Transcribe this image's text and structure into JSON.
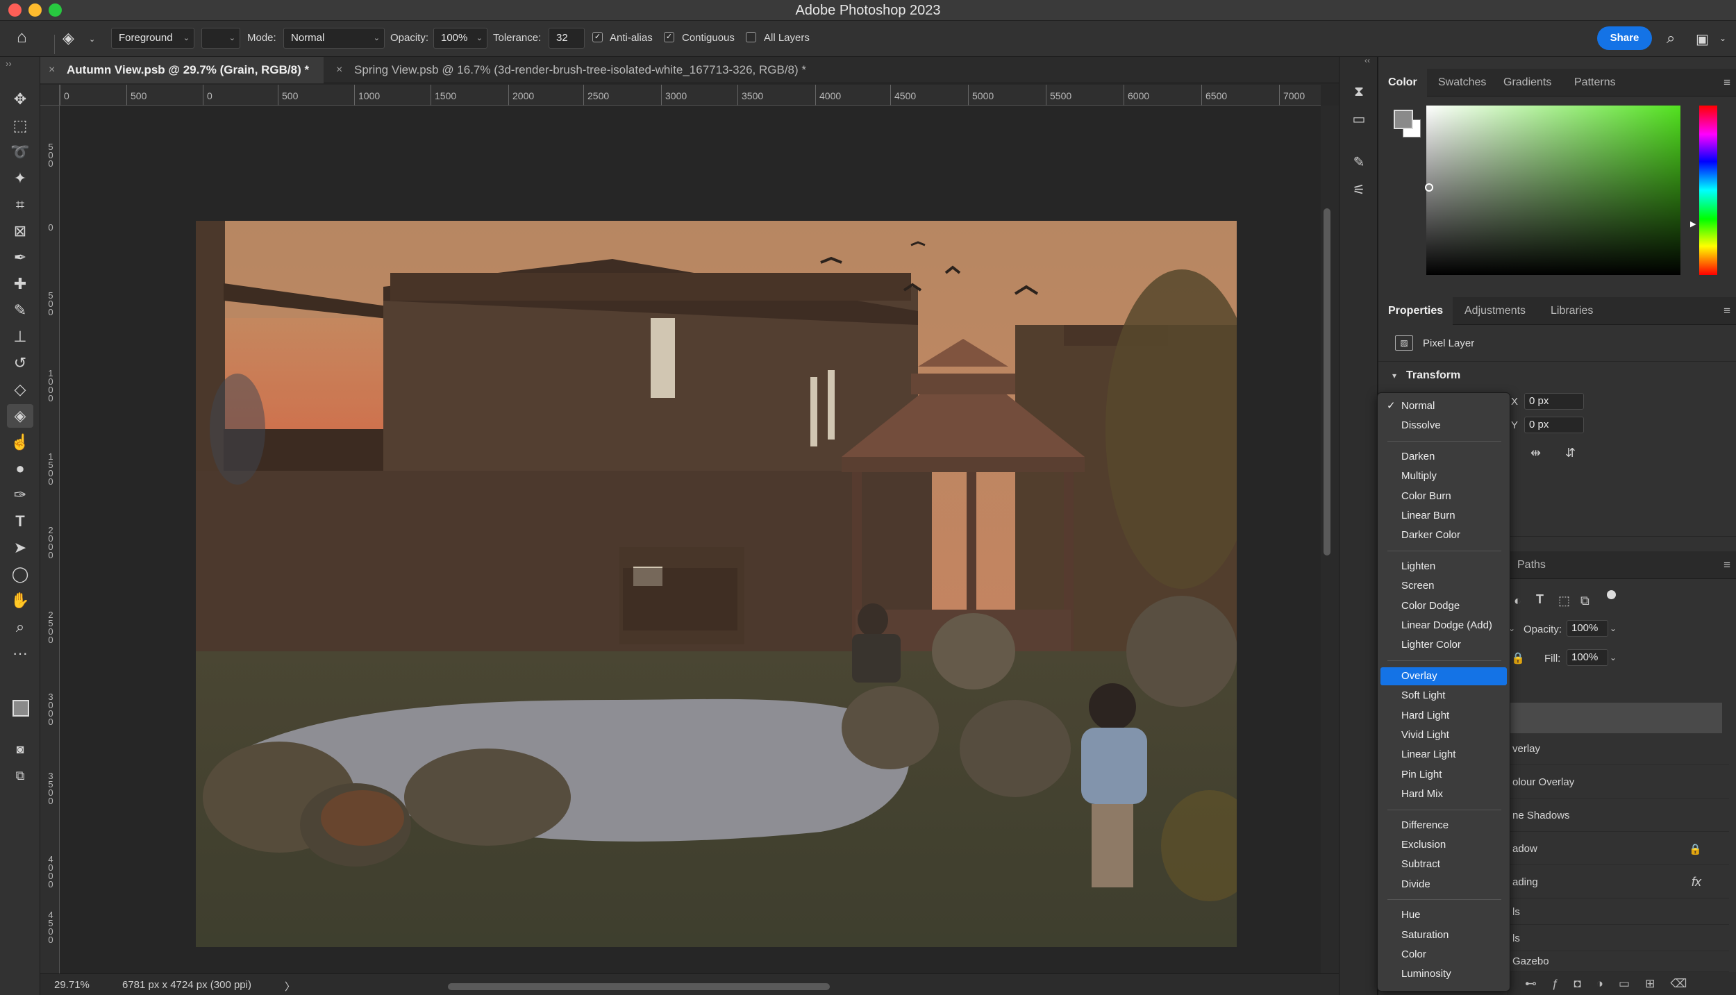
{
  "app": {
    "title": "Adobe Photoshop 2023"
  },
  "options": {
    "preset_label": "Foreground",
    "mode_label": "Mode:",
    "mode_value": "Normal",
    "opacity_label": "Opacity:",
    "opacity_value": "100%",
    "tolerance_label": "Tolerance:",
    "tolerance_value": "32",
    "antialias_label": "Anti-alias",
    "contiguous_label": "Contiguous",
    "all_layers_label": "All Layers",
    "share_label": "Share"
  },
  "tabs": [
    {
      "label": "Autumn View.psb @ 29.7% (Grain, RGB/8) *",
      "active": true
    },
    {
      "label": "Spring View.psb @ 16.7% (3d-render-brush-tree-isolated-white_167713-326, RGB/8) *",
      "active": false
    }
  ],
  "ruler_h": [
    "0",
    "500",
    "0",
    "500",
    "1000",
    "1500",
    "2000",
    "2500",
    "3000",
    "3500",
    "4000",
    "4500",
    "5000",
    "5500",
    "6000",
    "6500",
    "7000"
  ],
  "ruler_v": [
    "500",
    "0",
    "500",
    "1000",
    "1500",
    "2000",
    "2500",
    "3000",
    "3500",
    "4000",
    "4500"
  ],
  "status": {
    "zoom": "29.71%",
    "doc_info": "6781 px x 4724 px (300 ppi)",
    "arrow": "〉"
  },
  "color_panel": {
    "tabs": [
      "Color",
      "Swatches",
      "Gradients",
      "Patterns"
    ],
    "fg_color": "#8a8a8a",
    "bg_color": "#ffffff"
  },
  "props_panel": {
    "tabs": [
      "Properties",
      "Adjustments",
      "Libraries"
    ],
    "layer_type": "Pixel Layer",
    "transform_label": "Transform",
    "x_label": "X",
    "x_value": "0 px",
    "y_label": "Y",
    "y_value": "0 px"
  },
  "layers_panel": {
    "paths_tab": "Paths",
    "opacity_label": "Opacity:",
    "opacity_value": "100%",
    "fill_label": "Fill:",
    "fill_value": "100%",
    "rows": [
      "verlay",
      "olour Overlay",
      "ne Shadows",
      "adow",
      "ading",
      "ls",
      "ls",
      "Gazebo"
    ]
  },
  "blend_menu": {
    "groups": [
      [
        "Normal",
        "Dissolve"
      ],
      [
        "Darken",
        "Multiply",
        "Color Burn",
        "Linear Burn",
        "Darker Color"
      ],
      [
        "Lighten",
        "Screen",
        "Color Dodge",
        "Linear Dodge (Add)",
        "Lighter Color"
      ],
      [
        "Overlay",
        "Soft Light",
        "Hard Light",
        "Vivid Light",
        "Linear Light",
        "Pin Light",
        "Hard Mix"
      ],
      [
        "Difference",
        "Exclusion",
        "Subtract",
        "Divide"
      ],
      [
        "Hue",
        "Saturation",
        "Color",
        "Luminosity"
      ]
    ],
    "checked": "Normal",
    "highlighted": "Overlay"
  },
  "accent": "#1473e6"
}
